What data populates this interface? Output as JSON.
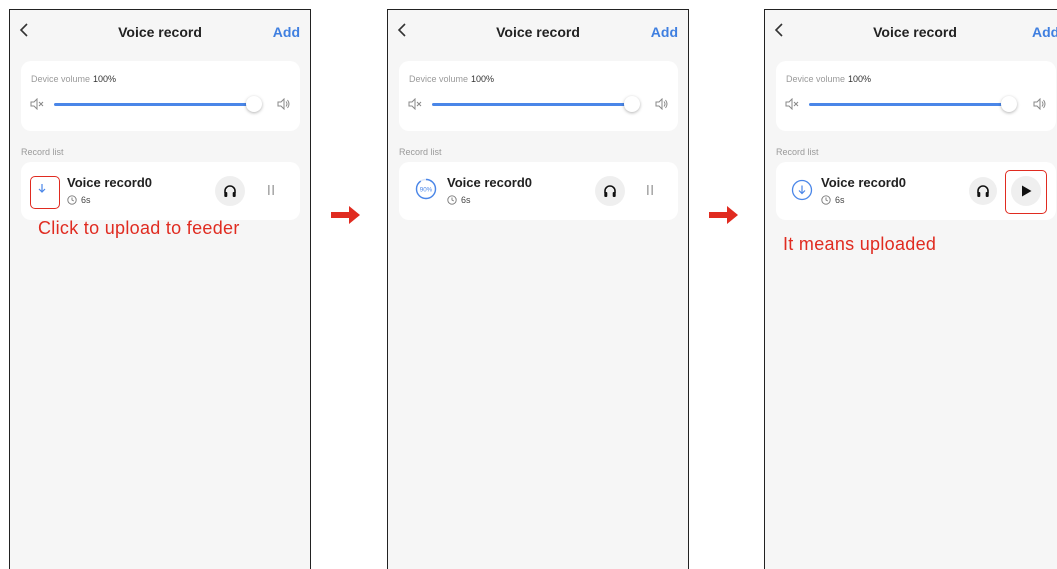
{
  "screens": [
    {
      "header": {
        "title": "Voice record",
        "add_label": "Add"
      },
      "volume": {
        "label": "Device volume",
        "value": "100%",
        "level": 1.0
      },
      "section_title": "Record list",
      "record": {
        "name": "Voice record0",
        "duration": "6s",
        "state": "not-uploaded",
        "control": "pause"
      },
      "annotation": "Click to upload to feeder"
    },
    {
      "header": {
        "title": "Voice record",
        "add_label": "Add"
      },
      "volume": {
        "label": "Device volume",
        "value": "100%",
        "level": 1.0
      },
      "section_title": "Record list",
      "record": {
        "name": "Voice record0",
        "duration": "6s",
        "state": "uploading",
        "progress": "90%",
        "control": "pause"
      }
    },
    {
      "header": {
        "title": "Voice record",
        "add_label": "Add"
      },
      "volume": {
        "label": "Device volume",
        "value": "100%",
        "level": 1.0
      },
      "section_title": "Record list",
      "record": {
        "name": "Voice record0",
        "duration": "6s",
        "state": "uploaded",
        "control": "play"
      },
      "annotation": "It means uploaded"
    }
  ],
  "colors": {
    "accent": "#4a86e8",
    "annotation": "#e02b20",
    "add_link": "#3f7fe0"
  },
  "icons": [
    "back-chevron-icon",
    "speaker-mute-icon",
    "speaker-loud-icon",
    "download-icon",
    "upload-progress-icon",
    "clock-icon",
    "headphones-icon",
    "pause-icon",
    "play-icon",
    "right-arrow-icon"
  ]
}
